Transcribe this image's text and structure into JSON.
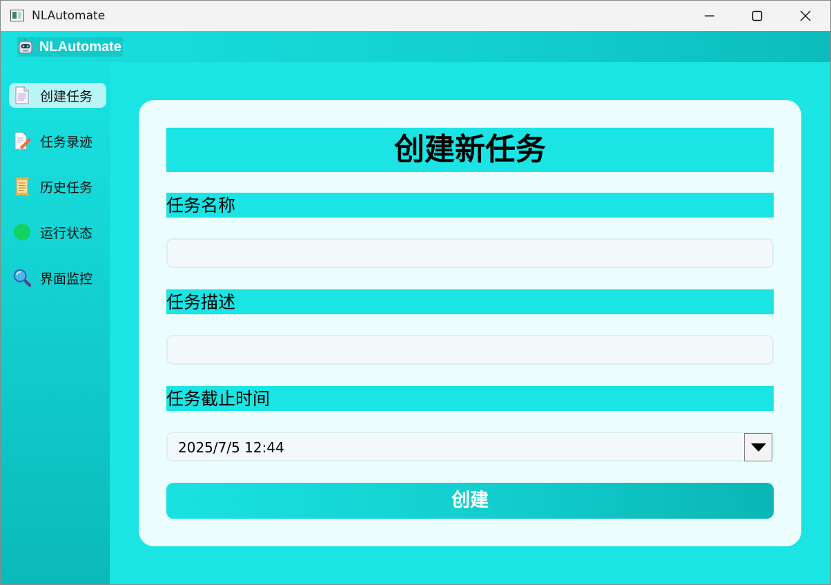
{
  "window": {
    "title": "NLAutomate"
  },
  "header": {
    "brand": "NLAutomate"
  },
  "sidebar": {
    "items": [
      {
        "label": "创建任务",
        "icon": "document-icon",
        "active": true
      },
      {
        "label": "任务录迹",
        "icon": "pencil-document-icon",
        "active": false
      },
      {
        "label": "历史任务",
        "icon": "scroll-icon",
        "active": false
      },
      {
        "label": "运行状态",
        "icon": "green-circle-icon",
        "active": false
      },
      {
        "label": "界面监控",
        "icon": "magnifier-icon",
        "active": false
      }
    ]
  },
  "form": {
    "title": "创建新任务",
    "name_label": "任务名称",
    "name_value": "",
    "desc_label": "任务描述",
    "desc_value": "",
    "deadline_label": "任务截止时间",
    "deadline_value": "2025/7/5 12:44",
    "submit_label": "创建"
  },
  "colors": {
    "accent": "#1ae4e4",
    "card": "#ecfdfd",
    "active_nav": "#baf5f5"
  }
}
